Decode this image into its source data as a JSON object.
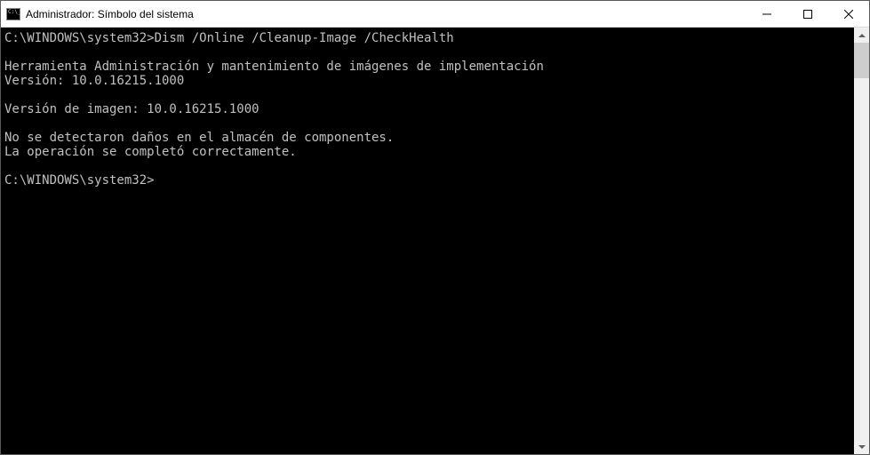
{
  "titlebar": {
    "title": "Administrador: Símbolo del sistema"
  },
  "terminal": {
    "prompt1": "C:\\WINDOWS\\system32>",
    "command1": "Dism /Online /Cleanup-Image /CheckHealth",
    "blank1": "",
    "line1": "Herramienta Administración y mantenimiento de imágenes de implementación",
    "line2": "Versión: 10.0.16215.1000",
    "blank2": "",
    "line3": "Versión de imagen: 10.0.16215.1000",
    "blank3": "",
    "line4": "No se detectaron daños en el almacén de componentes.",
    "line5": "La operación se completó correctamente.",
    "blank4": "",
    "prompt2": "C:\\WINDOWS\\system32>"
  }
}
